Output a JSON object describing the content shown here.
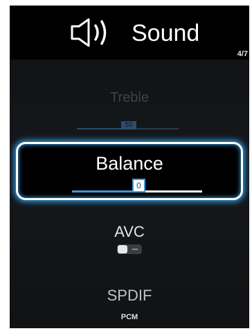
{
  "header": {
    "title": "Sound",
    "icon": "speaker-icon",
    "page_indicator": "4/7"
  },
  "menu": {
    "treble": {
      "label": "Treble",
      "value": "50",
      "level_percent": 50
    },
    "balance": {
      "label": "Balance",
      "value": "0",
      "level_percent": 50
    },
    "avc": {
      "label": "AVC",
      "state": "off"
    },
    "spdif": {
      "label": "SPDIF",
      "value": "PCM"
    }
  },
  "colors": {
    "accent": "#3a9ad9",
    "background": "#000000",
    "text": "#ffffff"
  }
}
